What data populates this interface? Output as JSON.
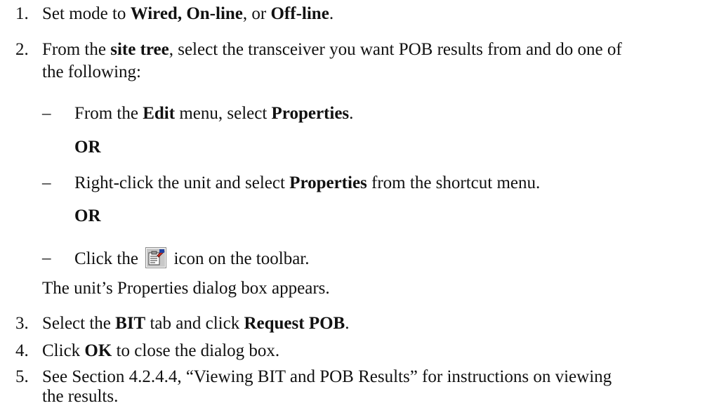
{
  "steps": [
    {
      "number": "1.",
      "set_mode": "Set mode to ",
      "wired_online": "Wired, On-line",
      "comma_or": ", or ",
      "offline": "Off-line",
      "period": "."
    },
    {
      "number": "2.",
      "from_the": "From the ",
      "site_tree": "site tree",
      "rest_line1": ", select the transceiver you want POB results from and do one of",
      "line2": "the following:",
      "options": [
        {
          "dash": "–",
          "prefix": "From the ",
          "edit": "Edit",
          "middle": " menu, select ",
          "properties": "Properties",
          "suffix": "."
        },
        {
          "dash": "–",
          "prefix": "Right-click the unit and select ",
          "properties": "Properties",
          "suffix": " from the shortcut menu."
        },
        {
          "dash": "–",
          "prefix": "Click the ",
          "icon_name": "properties-icon",
          "suffix": " icon on the toolbar."
        }
      ],
      "or_label": "OR",
      "result": "The unit’s Properties dialog box appears."
    },
    {
      "number": "3.",
      "select_the": "Select the ",
      "bit": "BIT",
      "tab_and_click": " tab and click ",
      "request_pob": "Request POB",
      "period": "."
    },
    {
      "number": "4.",
      "click": "Click ",
      "ok": "OK",
      "rest": " to close the dialog box."
    },
    {
      "number": "5.",
      "line1": "See Section 4.2.4.4, “Viewing BIT and POB Results” for instructions on viewing",
      "line2": "the results."
    }
  ]
}
